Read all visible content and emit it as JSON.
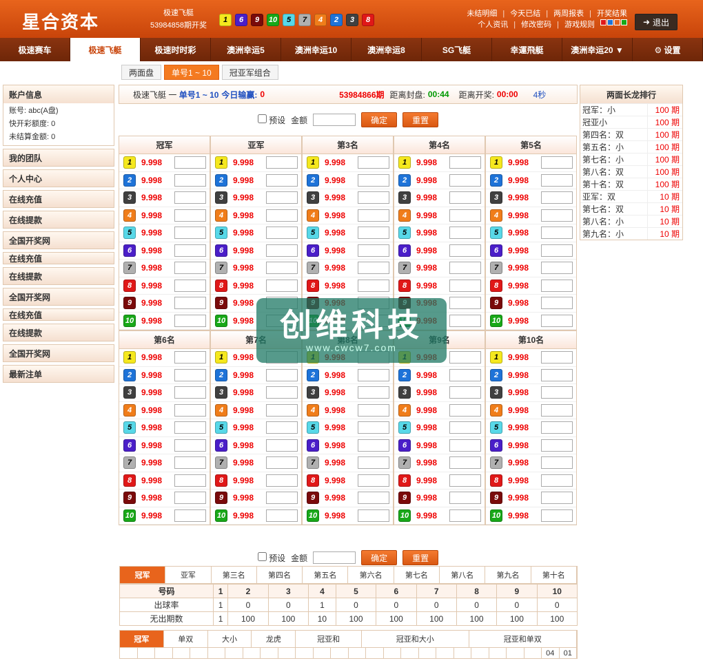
{
  "header": {
    "logo": "星合资本",
    "game": "极速飞艇",
    "draw": "53984858期开奖",
    "logout": "退出",
    "links_row1": [
      "未结明细",
      "今天已结",
      "两周报表",
      "开奖结果"
    ],
    "links_row2": [
      "个人资讯",
      "修改密码",
      "游戏规则"
    ],
    "result_balls": [
      1,
      6,
      9,
      10,
      5,
      7,
      4,
      2,
      3,
      8
    ],
    "ball_colors": {
      "1": "#f5e81e",
      "2": "#1e73d8",
      "3": "#404040",
      "4": "#f07d1a",
      "5": "#58d8e8",
      "6": "#4a1ec8",
      "7": "#b0b0b0",
      "8": "#e01818",
      "9": "#7a0a0a",
      "10": "#18a818"
    }
  },
  "nav": [
    "极速赛车",
    "极速飞艇",
    "极速时时彩",
    "澳洲幸运5",
    "澳洲幸运10",
    "澳洲幸运8",
    "SG飞艇",
    "幸運飛艇",
    "澳洲幸运20 ▼",
    "⚙ 设置"
  ],
  "subtabs": [
    "两面盘",
    "单号1 ~ 10",
    "冠亚军组合"
  ],
  "sidebar": {
    "account_title": "账户信息",
    "account": "账号:    abc(A盘)",
    "quota": "快开彩额度:    0",
    "unsettled": "未结算金额:    0",
    "items": [
      "我的团队",
      "个人中心",
      "在线充值",
      "在线提款",
      "全国开奖网",
      "在线充值",
      "在线提款",
      "全国开奖网",
      "在线充值",
      "在线提款",
      "全国开奖网",
      "最新注单"
    ]
  },
  "infobar": {
    "game": "极速飞艇",
    "dash": "一",
    "mode": "单号1 ~ 10",
    "profit_label": "今日输赢:",
    "profit": "0",
    "period": "53984866期",
    "close_label": "距离封盘:",
    "close": "00:44",
    "open_label": "距离开奖:",
    "open": "00:00",
    "refresh": "4秒"
  },
  "preset": {
    "label": "预设",
    "amount": "金额",
    "ok": "确定",
    "reset": "重置"
  },
  "positions": [
    "冠军",
    "亚军",
    "第3名",
    "第4名",
    "第5名",
    "第6名",
    "第7名",
    "第8名",
    "第9名",
    "第10名"
  ],
  "odds": "9.998",
  "longdragon": {
    "title": "两面长龙排行",
    "rows": [
      [
        "冠军：小",
        "100 期"
      ],
      [
        "冠亚小",
        "100 期"
      ],
      [
        "第四名：双",
        "100 期"
      ],
      [
        "第五名：小",
        "100 期"
      ],
      [
        "第七名：小",
        "100 期"
      ],
      [
        "第八名：双",
        "100 期"
      ],
      [
        "第十名：双",
        "100 期"
      ],
      [
        "亚军：双",
        "10 期"
      ],
      [
        "第七名：双",
        "10 期"
      ],
      [
        "第八名：小",
        "10 期"
      ],
      [
        "第九名：小",
        "10 期"
      ]
    ]
  },
  "stats": {
    "tabs": [
      "冠军",
      "亚军",
      "第三名",
      "第四名",
      "第五名",
      "第六名",
      "第七名",
      "第八名",
      "第九名",
      "第十名"
    ],
    "header": [
      "号码",
      "1",
      "2",
      "3",
      "4",
      "5",
      "6",
      "7",
      "8",
      "9",
      "10"
    ],
    "rate": [
      "出球率",
      "1",
      "0",
      "0",
      "1",
      "0",
      "0",
      "0",
      "0",
      "0",
      "0"
    ],
    "missing": [
      "无出期数",
      "1",
      "100",
      "100",
      "10",
      "100",
      "100",
      "100",
      "100",
      "100",
      "100"
    ],
    "lt_tabs": [
      "冠军",
      "单双",
      "大小",
      "龙虎",
      "冠亚和",
      "冠亚和大小",
      "冠亚和单双"
    ],
    "lt_tail": [
      "04",
      "01"
    ]
  },
  "watermark": {
    "title": "创维科技",
    "url": "www.cwcw7.com"
  }
}
